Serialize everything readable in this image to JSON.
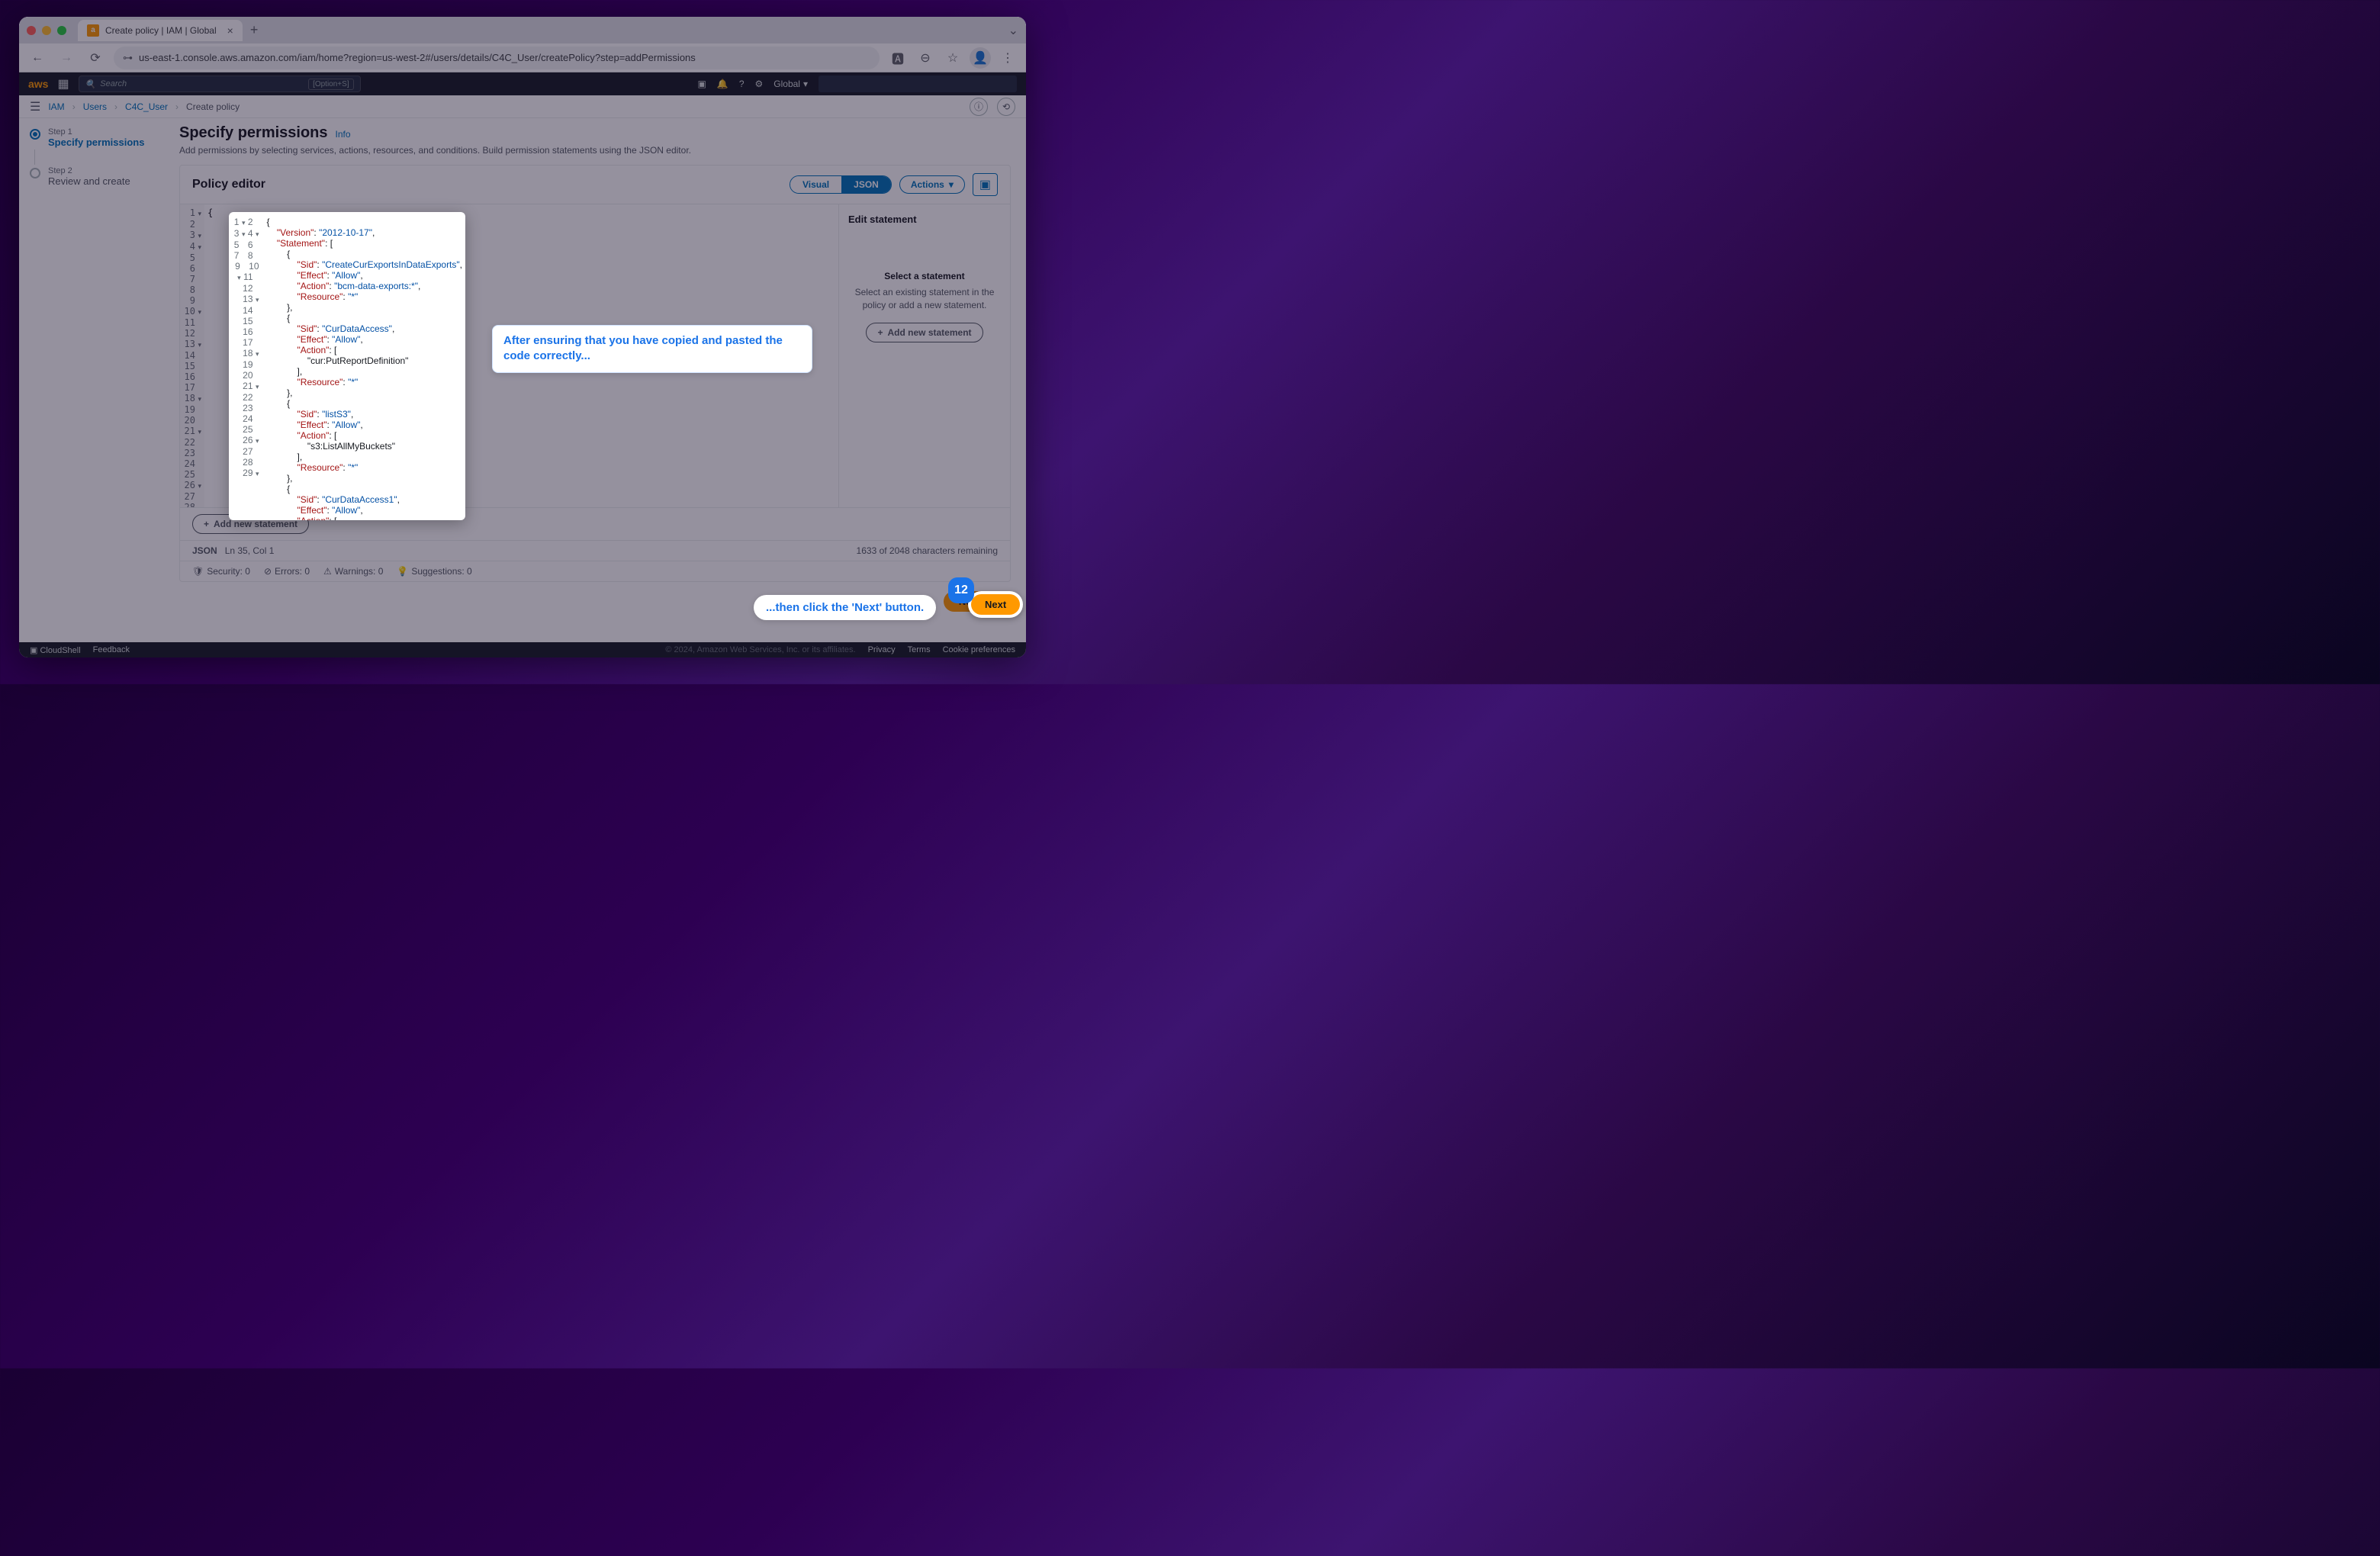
{
  "browser": {
    "tab_title": "Create policy | IAM | Global",
    "url": "us-east-1.console.aws.amazon.com/iam/home?region=us-west-2#/users/details/C4C_User/createPolicy?step=addPermissions"
  },
  "aws_header": {
    "search_placeholder": "Search",
    "search_shortcut": "[Option+S]",
    "region": "Global"
  },
  "breadcrumb": {
    "items": [
      "IAM",
      "Users",
      "C4C_User"
    ],
    "current": "Create policy"
  },
  "wizard": {
    "steps": [
      {
        "num": "Step 1",
        "label": "Specify permissions",
        "active": true
      },
      {
        "num": "Step 2",
        "label": "Review and create",
        "active": false
      }
    ]
  },
  "page": {
    "title": "Specify permissions",
    "info": "Info",
    "subtitle": "Add permissions by selecting services, actions, resources, and conditions. Build permission statements using the JSON editor."
  },
  "policy_editor": {
    "title": "Policy editor",
    "toggle": {
      "visual": "Visual",
      "json": "JSON"
    },
    "actions": "Actions",
    "side_panel": {
      "title": "Edit statement",
      "empty_title": "Select a statement",
      "empty_text": "Select an existing statement in the policy or add a new statement.",
      "add_btn": "Add new statement"
    },
    "add_statement": "Add new statement",
    "status": {
      "mode": "JSON",
      "cursor": "Ln 35, Col 1",
      "chars": "1633 of 2048 characters remaining"
    },
    "lint": {
      "security": "Security: 0",
      "errors": "Errors: 0",
      "warnings": "Warnings: 0",
      "suggestions": "Suggestions: 0"
    }
  },
  "code": {
    "json_text": "{\n    \"Version\": \"2012-10-17\",\n    \"Statement\": [\n        {\n            \"Sid\": \"CreateCurExportsInDataExports\",\n            \"Effect\": \"Allow\",\n            \"Action\": \"bcm-data-exports:*\",\n            \"Resource\": \"*\"\n        },\n        {\n            \"Sid\": \"CurDataAccess\",\n            \"Effect\": \"Allow\",\n            \"Action\": [\n                \"cur:PutReportDefinition\"\n            ],\n            \"Resource\": \"*\"\n        },\n        {\n            \"Sid\": \"listS3\",\n            \"Effect\": \"Allow\",\n            \"Action\": [\n                \"s3:ListAllMyBuckets\"\n            ],\n            \"Resource\": \"*\"\n        },\n        {\n            \"Sid\": \"CurDataAccess1\",\n            \"Effect\": \"Allow\",\n            \"Action\": ["
  },
  "buttons": {
    "next": "Next"
  },
  "footer": {
    "cloudshell": "CloudShell",
    "feedback": "Feedback",
    "copyright": "© 2024, Amazon Web Services, Inc. or its affiliates.",
    "privacy": "Privacy",
    "terms": "Terms",
    "cookies": "Cookie preferences"
  },
  "callouts": {
    "c1": "After ensuring that you have copied and pasted the code correctly...",
    "c2": "...then click the 'Next' button.",
    "step_num": "12"
  }
}
